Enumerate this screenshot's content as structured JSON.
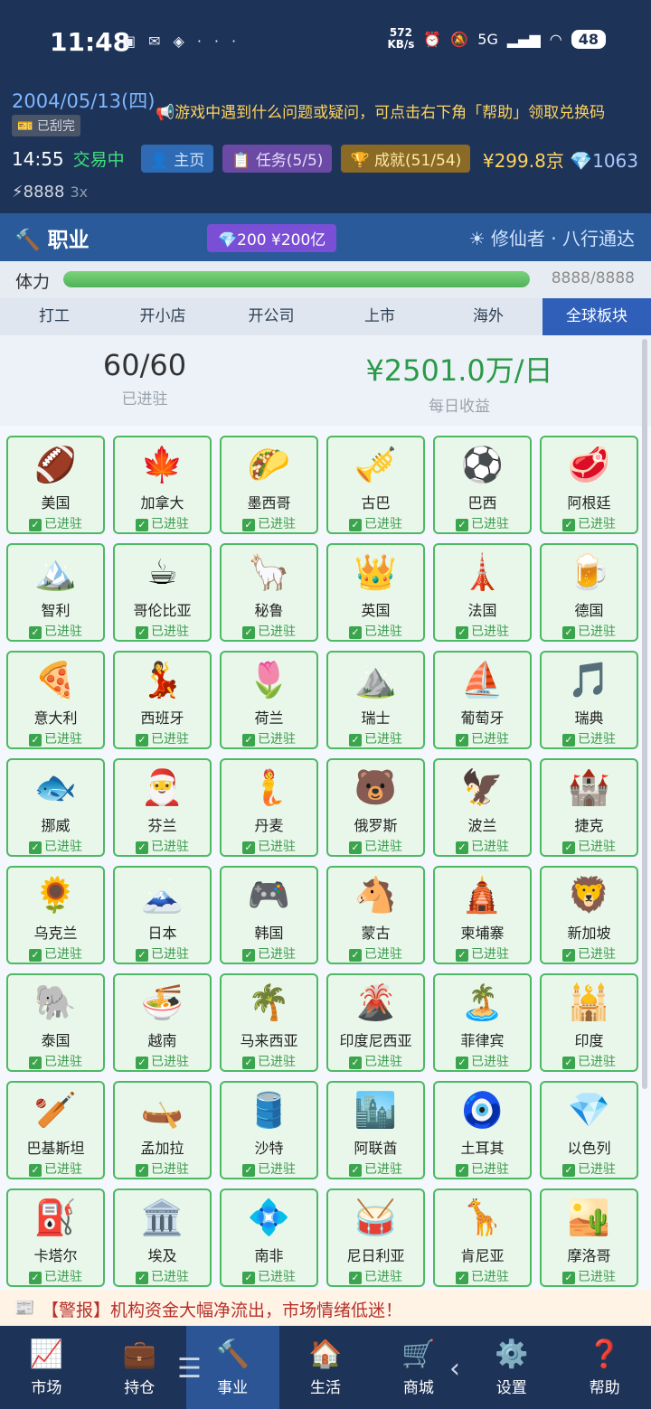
{
  "status": {
    "time": "11:48",
    "net_speed": "572",
    "net_unit": "KB/s",
    "network": "5G",
    "battery": "48",
    "icons": [
      "wechat-icon",
      "mail-icon",
      "app-icon",
      "more-dots-icon"
    ]
  },
  "header": {
    "date": "2004/05/13(四)",
    "scratch": "已刮完",
    "notice": "游戏中遇到什么问题或疑问，可点击右下角「帮助」领取兑换码",
    "clock": "14:55",
    "trading": "交易中",
    "home": "主页",
    "tasks": "任务(5/5)",
    "achievements": "成就(51/54)",
    "money": "¥299.8京",
    "diamonds": "1063",
    "energy": "⚡8888",
    "multiplier": "3x"
  },
  "career": {
    "title": "职业",
    "cost": "200 ¥200亿",
    "role": "修仙者 · 八行通达"
  },
  "stamina": {
    "label": "体力",
    "value": "8888/8888",
    "fraction": 1.0
  },
  "tabs": [
    "打工",
    "开小店",
    "开公司",
    "上市",
    "海外",
    "全球板块"
  ],
  "active_tab": 5,
  "stats": {
    "count": "60/60",
    "count_label": "已进驻",
    "income": "¥2501.0万/日",
    "income_label": "每日收益"
  },
  "status_label": "已进驻",
  "countries": [
    {
      "name": "美国",
      "emoji": "🏈"
    },
    {
      "name": "加拿大",
      "emoji": "🍁"
    },
    {
      "name": "墨西哥",
      "emoji": "🌮"
    },
    {
      "name": "古巴",
      "emoji": "🎺"
    },
    {
      "name": "巴西",
      "emoji": "⚽"
    },
    {
      "name": "阿根廷",
      "emoji": "🥩"
    },
    {
      "name": "智利",
      "emoji": "🏔️"
    },
    {
      "name": "哥伦比亚",
      "emoji": "☕"
    },
    {
      "name": "秘鲁",
      "emoji": "🦙"
    },
    {
      "name": "英国",
      "emoji": "👑"
    },
    {
      "name": "法国",
      "emoji": "🗼"
    },
    {
      "name": "德国",
      "emoji": "🍺"
    },
    {
      "name": "意大利",
      "emoji": "🍕"
    },
    {
      "name": "西班牙",
      "emoji": "💃"
    },
    {
      "name": "荷兰",
      "emoji": "🌷"
    },
    {
      "name": "瑞士",
      "emoji": "⛰️"
    },
    {
      "name": "葡萄牙",
      "emoji": "⛵"
    },
    {
      "name": "瑞典",
      "emoji": "🎵"
    },
    {
      "name": "挪威",
      "emoji": "🐟"
    },
    {
      "name": "芬兰",
      "emoji": "🎅"
    },
    {
      "name": "丹麦",
      "emoji": "🧜"
    },
    {
      "name": "俄罗斯",
      "emoji": "🐻"
    },
    {
      "name": "波兰",
      "emoji": "🦅"
    },
    {
      "name": "捷克",
      "emoji": "🏰"
    },
    {
      "name": "乌克兰",
      "emoji": "🌻"
    },
    {
      "name": "日本",
      "emoji": "🗻"
    },
    {
      "name": "韩国",
      "emoji": "🎮"
    },
    {
      "name": "蒙古",
      "emoji": "🐴"
    },
    {
      "name": "柬埔寨",
      "emoji": "🛕"
    },
    {
      "name": "新加坡",
      "emoji": "🦁"
    },
    {
      "name": "泰国",
      "emoji": "🐘"
    },
    {
      "name": "越南",
      "emoji": "🍜"
    },
    {
      "name": "马来西亚",
      "emoji": "🌴"
    },
    {
      "name": "印度尼西亚",
      "emoji": "🌋"
    },
    {
      "name": "菲律宾",
      "emoji": "🏝️"
    },
    {
      "name": "印度",
      "emoji": "🕌"
    },
    {
      "name": "巴基斯坦",
      "emoji": "🏏"
    },
    {
      "name": "孟加拉",
      "emoji": "🛶"
    },
    {
      "name": "沙特",
      "emoji": "🛢️"
    },
    {
      "name": "阿联酋",
      "emoji": "🏙️"
    },
    {
      "name": "土耳其",
      "emoji": "🧿"
    },
    {
      "name": "以色列",
      "emoji": "💎"
    },
    {
      "name": "卡塔尔",
      "emoji": "⛽"
    },
    {
      "name": "埃及",
      "emoji": "🏛️"
    },
    {
      "name": "南非",
      "emoji": "💠"
    },
    {
      "name": "尼日利亚",
      "emoji": "🥁"
    },
    {
      "name": "肯尼亚",
      "emoji": "🦒"
    },
    {
      "name": "摩洛哥",
      "emoji": "🏜️"
    }
  ],
  "alert": "【警报】机构资金大幅净流出，市场情绪低迷！",
  "nav": [
    {
      "label": "市场",
      "icon": "📈"
    },
    {
      "label": "持仓",
      "icon": "💼"
    },
    {
      "label": "事业",
      "icon": "🔨"
    },
    {
      "label": "生活",
      "icon": "🏠"
    },
    {
      "label": "商城",
      "icon": "🛒"
    },
    {
      "label": "设置",
      "icon": "⚙️"
    },
    {
      "label": "帮助",
      "icon": "❓"
    }
  ],
  "active_nav": 2
}
